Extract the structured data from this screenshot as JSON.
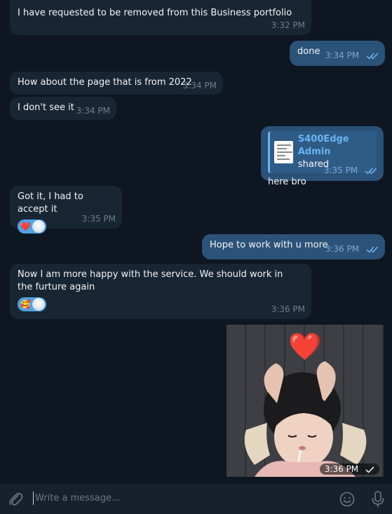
{
  "messages": [
    {
      "text": "I have requested to be removed from this Business portfolio",
      "time": "3:32 PM"
    },
    {
      "text": "done",
      "time": "3:34 PM"
    },
    {
      "text": "How about the page that is from 2022",
      "time": "3:34 PM"
    },
    {
      "text": "I don't see it",
      "time": "3:34 PM"
    },
    {
      "share_title": "S400Edge Admin",
      "share_sub": "shared",
      "text": "here bro",
      "time": "3:35 PM"
    },
    {
      "text": "Got it, I had to accept it",
      "time": "3:35 PM",
      "reaction": "❤️"
    },
    {
      "text": "Hope to work with u more",
      "time": "3:36 PM"
    },
    {
      "text": "Now I am more happy with the service. We should work in the furture again",
      "time": "3:36 PM",
      "reaction": "🥰"
    },
    {
      "photo_time": "3:36 PM",
      "photo_heart": "❤️"
    }
  ],
  "input": {
    "placeholder": "Write a message..."
  },
  "icons": {
    "attach": "paperclip-icon",
    "emoji": "smiley-icon",
    "voice": "microphone-icon",
    "read": "double-check-icon",
    "sent": "single-check-icon"
  },
  "colors": {
    "background": "#0e1621",
    "incoming": "#182533",
    "outgoing": "#2b5278",
    "accent": "#4fa3e5",
    "input_bar": "#17212b"
  }
}
